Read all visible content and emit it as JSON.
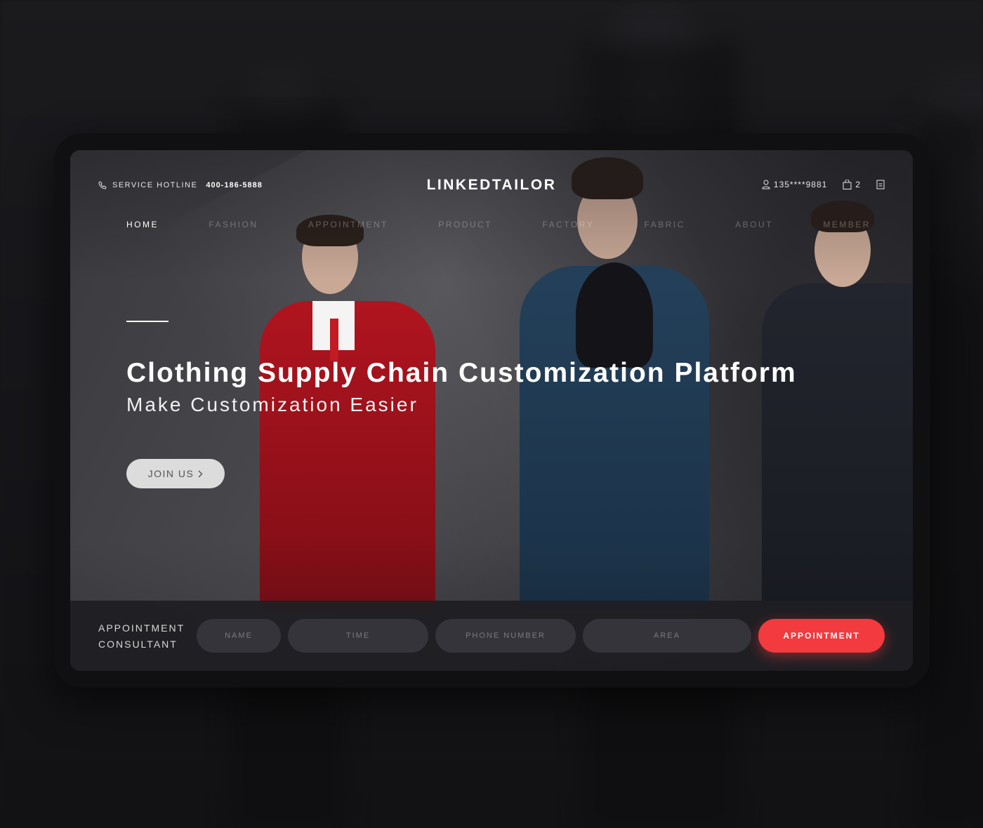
{
  "header": {
    "hotline_label": "SERVICE HOTLINE",
    "hotline_number": "400-186-5888",
    "logo": "LINKEDTAILOR",
    "user_phone": "135****9881",
    "cart_count": "2"
  },
  "nav": {
    "items": [
      {
        "label": "HOME"
      },
      {
        "label": "FASHION"
      },
      {
        "label": "APPOINTMENT"
      },
      {
        "label": "PRODUCT"
      },
      {
        "label": "FACTORY"
      },
      {
        "label": "FABRIC"
      },
      {
        "label": "ABOUT"
      },
      {
        "label": "MEMBER"
      }
    ],
    "active": "HOME"
  },
  "hero": {
    "title": "Clothing Supply Chain Customization Platform",
    "subtitle": "Make Customization Easier",
    "join_label": "JOIN US"
  },
  "appointment": {
    "label_line1": "APPOINTMENT",
    "label_line2": "CONSULTANT",
    "fields": [
      {
        "placeholder": "NAME"
      },
      {
        "placeholder": "TIME"
      },
      {
        "placeholder": "PHONE NUMBER"
      },
      {
        "placeholder": "AREA"
      }
    ],
    "button_label": "APPOINTMENT"
  },
  "colors": {
    "accent": "#f23a3f",
    "background": "#141416",
    "coat_red": "#a0121d",
    "coat_blue": "#1f3d57",
    "coat_dark": "#1d1f27"
  },
  "icons": [
    "phone-icon",
    "user-icon",
    "bag-icon",
    "document-icon",
    "chevron-right-icon"
  ]
}
